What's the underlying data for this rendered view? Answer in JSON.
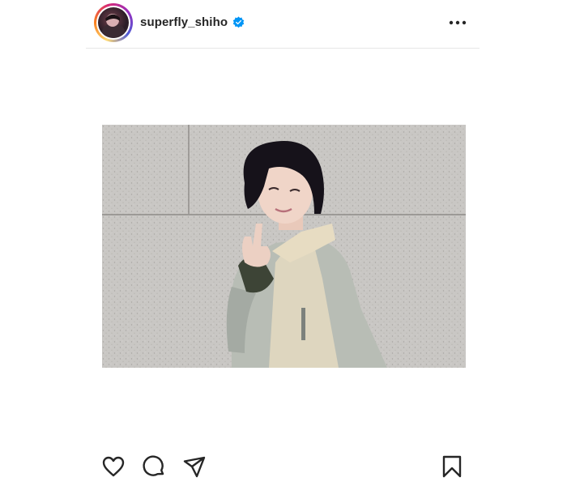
{
  "post": {
    "username": "superfly_shiho",
    "verified": true,
    "avatar": "profile-photo",
    "menu_icon": "more-horizontal-icon",
    "photo": "woman-peace-sign-photo"
  },
  "actions": {
    "like_icon": "heart-icon",
    "comment_icon": "comment-icon",
    "share_icon": "send-icon",
    "save_icon": "bookmark-icon"
  },
  "colors": {
    "text": "#262626",
    "verified_badge": "#0095f6",
    "divider": "#e6e6e6"
  }
}
